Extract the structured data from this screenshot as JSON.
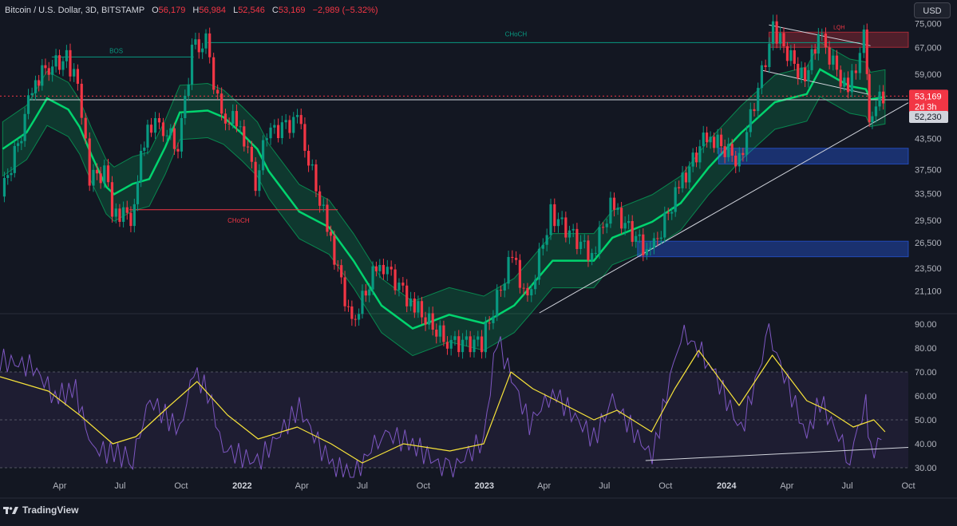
{
  "header": {
    "symbol": "Bitcoin / U.S. Dollar, 3D, BITSTAMP",
    "o_label": "O",
    "o_val": "56,179",
    "h_label": "H",
    "h_val": "56,984",
    "l_label": "L",
    "l_val": "52,546",
    "c_label": "C",
    "c_val": "53,169",
    "change": "−2,989 (−5.32%)"
  },
  "currency_button": "USD",
  "brand": "TradingView",
  "colors": {
    "background": "#131722",
    "bull": "#089981",
    "bear": "#f23645",
    "rsi_line": "#7e57c2",
    "rsi_ma": "#f7e33a",
    "band_green": "#00e676",
    "band_red": "#e91e63",
    "zone_blue": "#2962ff"
  },
  "chart_data": [
    {
      "type": "candlestick",
      "title": "Bitcoin / U.S. Dollar, 3D, BITSTAMP",
      "y_scale": "log",
      "ylim": [
        19000,
        76000
      ],
      "y_ticks": [
        "75,000",
        "67,000",
        "59,000",
        "53,169",
        "52,230",
        "43,500",
        "37,500",
        "33,500",
        "29,500",
        "26,500",
        "23,500",
        "21,100"
      ],
      "price_labels": {
        "last": "53,169",
        "countdown": "2d 3h",
        "level": "52,230"
      },
      "annotations": [
        "BOS",
        "CHoCH",
        "CHoCH",
        "LQH"
      ],
      "x_ticks": [
        "Apr",
        "Jul",
        "Oct",
        "2022",
        "Apr",
        "Jul",
        "Oct",
        "2023",
        "Apr",
        "Jul",
        "Oct",
        "2024",
        "Apr",
        "Jul",
        "Oct"
      ],
      "x_range": [
        "2021-01",
        "2024-10"
      ],
      "ohlc_last": {
        "open": 56179,
        "high": 56984,
        "low": 52546,
        "close": 53169,
        "change": -2989,
        "change_pct": -5.32
      },
      "series": [
        {
          "values": [
            [
              "2021-01-05",
              33000
            ],
            [
              "2021-02-10",
              47000
            ],
            [
              "2021-02-21",
              56000
            ],
            [
              "2021-03-13",
              60500
            ],
            [
              "2021-04-14",
              63500
            ],
            [
              "2021-05-01",
              56000
            ],
            [
              "2021-05-19",
              36000
            ],
            [
              "2021-06-10",
              37000
            ],
            [
              "2021-06-22",
              31000
            ],
            [
              "2021-07-20",
              30000
            ],
            [
              "2021-08-14",
              47000
            ],
            [
              "2021-09-07",
              46000
            ],
            [
              "2021-09-29",
              41500
            ],
            [
              "2021-10-20",
              66000
            ],
            [
              "2021-11-10",
              68500
            ],
            [
              "2021-12-04",
              48000
            ],
            [
              "2022-01-01",
              47000
            ],
            [
              "2022-01-24",
              35500
            ],
            [
              "2022-02-10",
              44500
            ],
            [
              "2022-03-28",
              47500
            ],
            [
              "2022-05-12",
              28500
            ],
            [
              "2022-06-18",
              18000
            ],
            [
              "2022-07-30",
              24500
            ],
            [
              "2022-09-15",
              20000
            ],
            [
              "2022-11-09",
              16500
            ],
            [
              "2022-12-31",
              16500
            ],
            [
              "2023-02-15",
              25000
            ],
            [
              "2023-03-10",
              20000
            ],
            [
              "2023-04-14",
              30500
            ],
            [
              "2023-06-15",
              25000
            ],
            [
              "2023-07-13",
              31500
            ],
            [
              "2023-09-11",
              25000
            ],
            [
              "2023-10-24",
              34500
            ],
            [
              "2023-12-05",
              44500
            ],
            [
              "2024-01-23",
              39000
            ],
            [
              "2024-03-14",
              73000
            ],
            [
              "2024-05-01",
              57000
            ],
            [
              "2024-05-21",
              71500
            ],
            [
              "2024-07-05",
              54000
            ],
            [
              "2024-07-29",
              70000
            ],
            [
              "2024-08-05",
              49000
            ],
            [
              "2024-08-27",
              53169
            ]
          ]
        },
        {
          "name": "RSI",
          "ylim": [
            26,
            92
          ],
          "y_ticks": [
            "90.00",
            "80.00",
            "70.00",
            "60.00",
            "50.00",
            "40.00",
            "30.00"
          ],
          "levels": [
            70,
            50,
            30
          ],
          "values": [
            [
              "2021-01-01",
              75
            ],
            [
              "2021-02-20",
              72
            ],
            [
              "2021-03-25",
              60
            ],
            [
              "2021-04-25",
              62
            ],
            [
              "2021-05-20",
              38
            ],
            [
              "2021-06-22",
              36
            ],
            [
              "2021-07-20",
              34
            ],
            [
              "2021-08-15",
              58
            ],
            [
              "2021-09-07",
              52
            ],
            [
              "2021-09-29",
              45
            ],
            [
              "2021-10-20",
              70
            ],
            [
              "2021-11-10",
              62
            ],
            [
              "2021-12-04",
              38
            ],
            [
              "2022-01-24",
              32
            ],
            [
              "2022-03-28",
              55
            ],
            [
              "2022-05-12",
              32
            ],
            [
              "2022-06-18",
              26
            ],
            [
              "2022-07-30",
              45
            ],
            [
              "2022-09-15",
              40
            ],
            [
              "2022-11-09",
              28
            ],
            [
              "2022-12-31",
              42
            ],
            [
              "2023-01-20",
              84
            ],
            [
              "2023-03-10",
              48
            ],
            [
              "2023-04-14",
              62
            ],
            [
              "2023-06-15",
              42
            ],
            [
              "2023-07-13",
              58
            ],
            [
              "2023-09-11",
              34
            ],
            [
              "2023-10-24",
              87
            ],
            [
              "2023-12-05",
              75
            ],
            [
              "2024-01-23",
              45
            ],
            [
              "2024-03-05",
              86
            ],
            [
              "2024-05-01",
              43
            ],
            [
              "2024-05-21",
              58
            ],
            [
              "2024-07-05",
              34
            ],
            [
              "2024-07-29",
              58
            ],
            [
              "2024-08-05",
              36
            ],
            [
              "2024-08-27",
              44
            ]
          ]
        },
        {
          "name": "RSI MA",
          "values": [
            [
              "2021-01-01",
              68
            ],
            [
              "2021-03-15",
              62
            ],
            [
              "2021-05-01",
              52
            ],
            [
              "2021-06-20",
              40
            ],
            [
              "2021-07-25",
              43
            ],
            [
              "2021-09-10",
              55
            ],
            [
              "2021-10-25",
              66
            ],
            [
              "2021-12-10",
              52
            ],
            [
              "2022-01-25",
              42
            ],
            [
              "2022-03-25",
              47
            ],
            [
              "2022-05-15",
              40
            ],
            [
              "2022-07-01",
              32
            ],
            [
              "2022-09-01",
              40
            ],
            [
              "2022-11-10",
              37
            ],
            [
              "2022-12-31",
              40
            ],
            [
              "2023-02-10",
              70
            ],
            [
              "2023-03-15",
              63
            ],
            [
              "2023-04-20",
              58
            ],
            [
              "2023-06-15",
              50
            ],
            [
              "2023-07-20",
              54
            ],
            [
              "2023-09-10",
              45
            ],
            [
              "2023-10-15",
              63
            ],
            [
              "2023-11-20",
              79
            ],
            [
              "2024-01-20",
              56
            ],
            [
              "2024-03-10",
              77
            ],
            [
              "2024-05-01",
              58
            ],
            [
              "2024-06-01",
              54
            ],
            [
              "2024-07-10",
              47
            ],
            [
              "2024-08-10",
              50
            ],
            [
              "2024-08-27",
              45
            ]
          ]
        }
      ]
    }
  ]
}
